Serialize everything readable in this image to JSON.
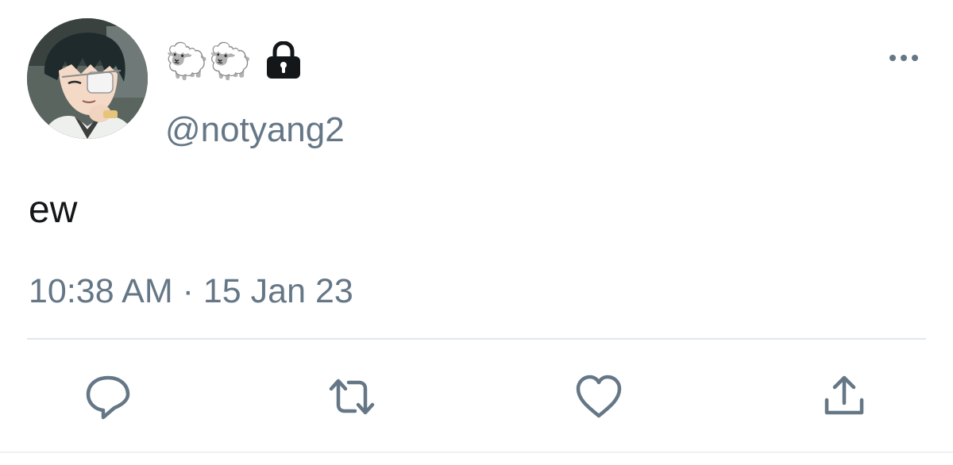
{
  "tweet": {
    "display_name": "🐑🐑",
    "handle": "@notyang2",
    "text": "ew",
    "timestamp": "10:38 AM · 15 Jan 23",
    "account_locked": true
  },
  "icons": {
    "avatar": "profile-picture",
    "lock": "lock-icon",
    "more": "more-options-icon",
    "reply": "reply-icon",
    "retweet": "retweet-icon",
    "like": "heart-icon",
    "share": "share-icon"
  },
  "colors": {
    "text": "#14171a",
    "secondary": "#657786",
    "divider": "#e1e8ed",
    "background": "#ffffff"
  }
}
